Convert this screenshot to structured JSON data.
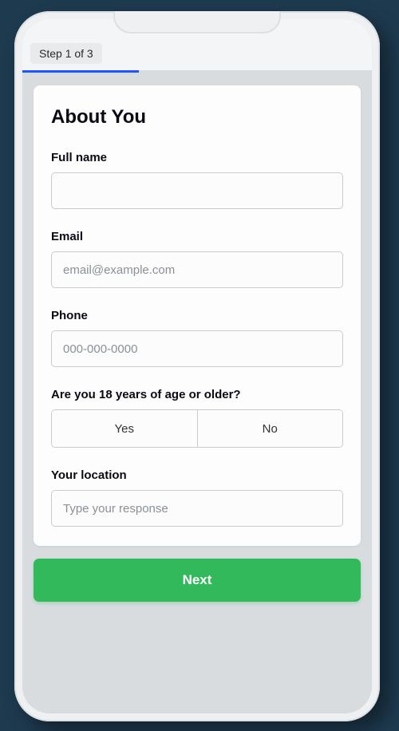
{
  "progress": {
    "step_label": "Step 1 of 3",
    "percent": 33.33
  },
  "card": {
    "title": "About You",
    "fields": {
      "full_name": {
        "label": "Full name",
        "value": "",
        "placeholder": ""
      },
      "email": {
        "label": "Email",
        "value": "",
        "placeholder": "email@example.com"
      },
      "phone": {
        "label": "Phone",
        "value": "",
        "placeholder": "000-000-0000"
      },
      "age_check": {
        "label": "Are you 18 years of age or older?",
        "options": {
          "yes": "Yes",
          "no": "No"
        }
      },
      "location": {
        "label": "Your location",
        "value": "",
        "placeholder": "Type your response"
      }
    }
  },
  "actions": {
    "next": "Next"
  },
  "colors": {
    "progress": "#1f54ff",
    "primary_button": "#31b95c"
  }
}
